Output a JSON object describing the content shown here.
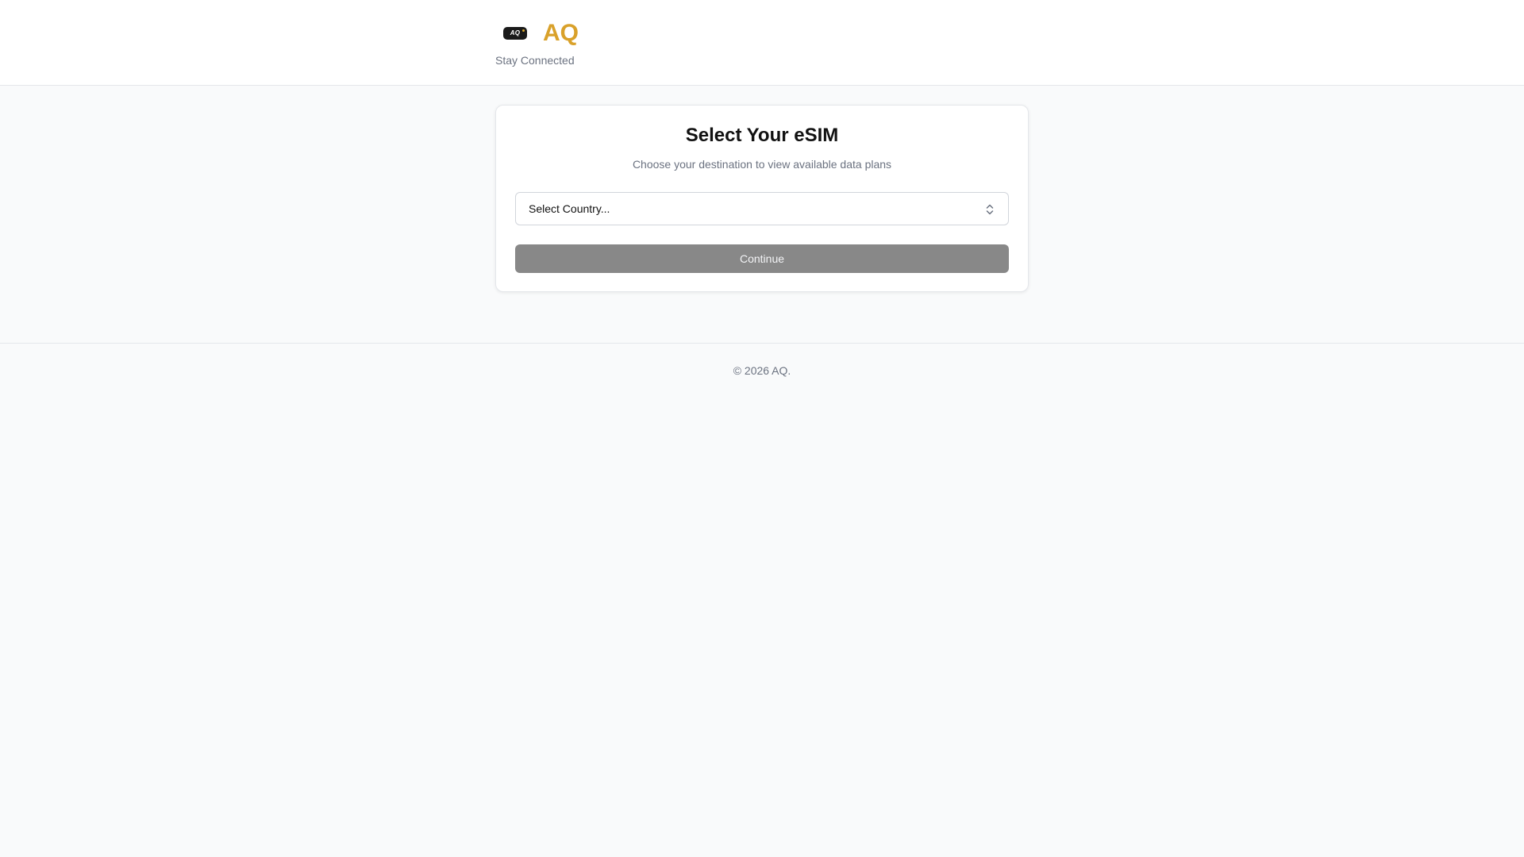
{
  "header": {
    "logo_text": "AQ",
    "brand_name": "AQ",
    "tagline": "Stay Connected"
  },
  "card": {
    "title": "Select Your eSIM",
    "subtitle": "Choose your destination to view available data plans",
    "country_select": {
      "value": "Select Country...",
      "icon": "chevron-up-down-icon"
    },
    "continue_label": "Continue"
  },
  "footer": {
    "copyright": "© 2026 AQ."
  },
  "colors": {
    "brand": "#d9a12a",
    "button_disabled": "#888888",
    "background": "#f9fafb"
  }
}
